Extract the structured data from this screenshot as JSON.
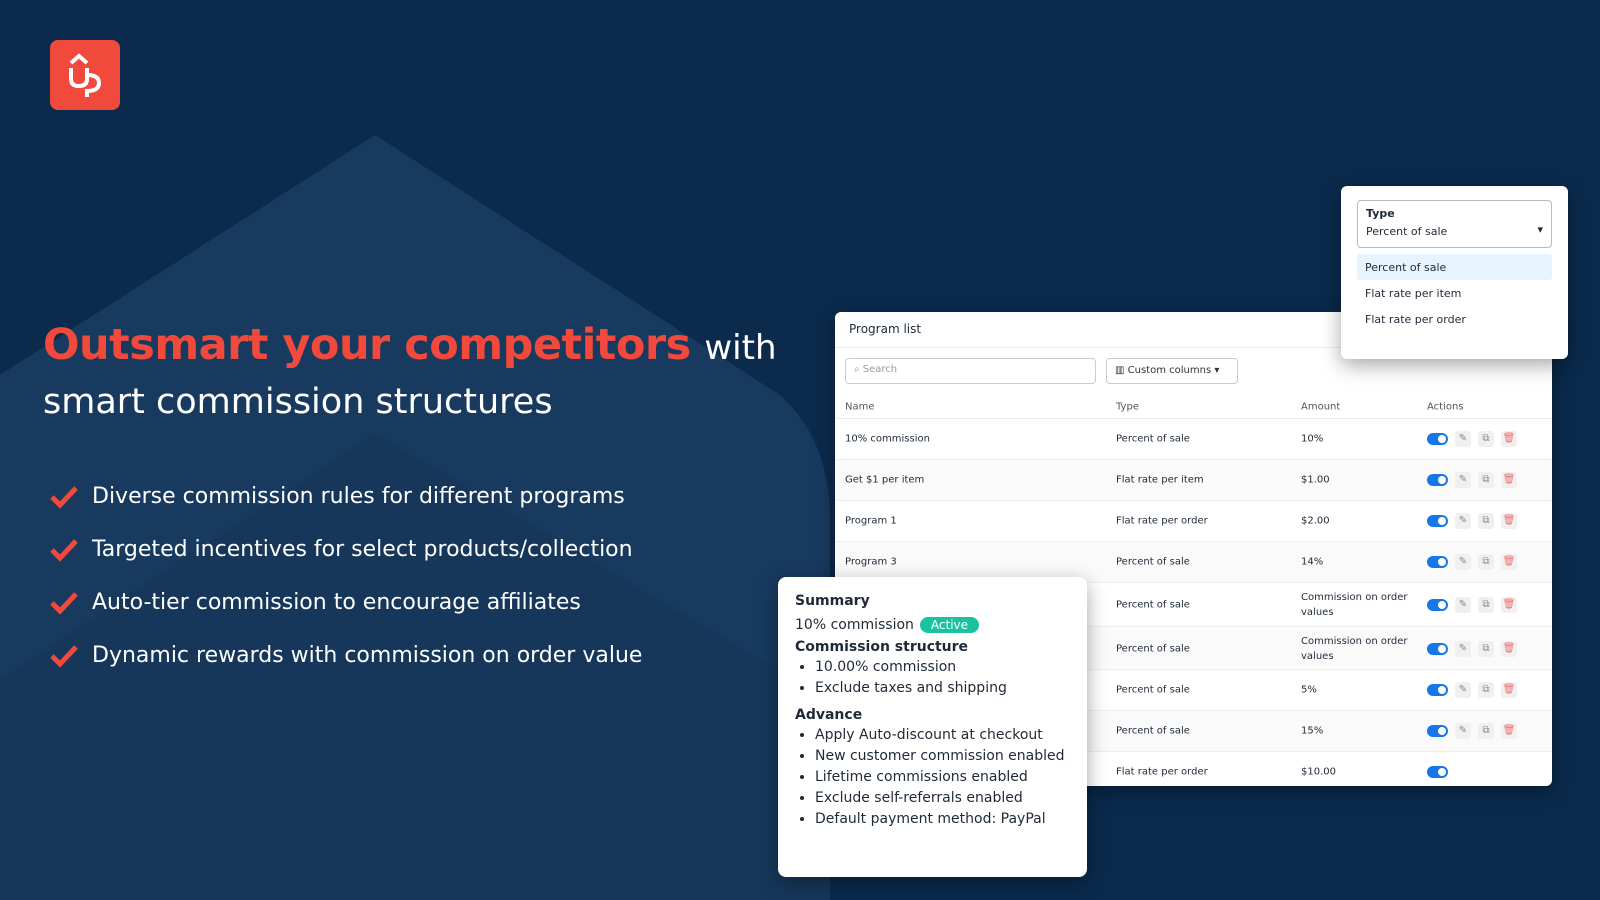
{
  "brand": {
    "logo_text": "Up",
    "color": "#f2493d"
  },
  "hero": {
    "highlight": "Outsmart your competitors",
    "rest": "with",
    "subtitle": "smart commission structures",
    "bullets": [
      "Diverse commission rules for different programs",
      "Targeted incentives for select products/collection",
      "Auto-tier commission to encourage affiliates",
      "Dynamic rewards with commission on order value"
    ]
  },
  "program_list": {
    "title": "Program list",
    "search_placeholder": "Search",
    "custom_columns": "Custom columns",
    "columns": [
      "Name",
      "Type",
      "Amount",
      "Actions"
    ],
    "rows": [
      {
        "name": "10% commission",
        "type": "Percent of sale",
        "amount": "10%"
      },
      {
        "name": "Get $1 per item",
        "type": "Flat rate per item",
        "amount": "$1.00"
      },
      {
        "name": "Program 1",
        "type": "Flat rate per order",
        "amount": "$2.00"
      },
      {
        "name": "Program 3",
        "type": "Percent of sale",
        "amount": "14%"
      },
      {
        "name": "",
        "type": "Percent of sale",
        "amount": "Commission on order values"
      },
      {
        "name": "",
        "type": "Percent of sale",
        "amount": "Commission on order values"
      },
      {
        "name": "",
        "type": "Percent of sale",
        "amount": "5%"
      },
      {
        "name": "",
        "type": "Percent of sale",
        "amount": "15%"
      },
      {
        "name": "",
        "type": "Flat rate per order",
        "amount": "$10.00"
      }
    ]
  },
  "type_dropdown": {
    "label": "Type",
    "value": "Percent of sale",
    "options": [
      "Percent of sale",
      "Flat rate per item",
      "Flat rate per order"
    ]
  },
  "summary": {
    "title": "Summary",
    "program": "10% commission",
    "status": "Active",
    "structure_title": "Commission structure",
    "structure": [
      "10.00% commission",
      "Exclude taxes and shipping"
    ],
    "advance_title": "Advance",
    "advance": [
      "Apply Auto-discount at checkout",
      "New customer commission enabled",
      "Lifetime commissions enabled",
      "Exclude self-referrals enabled",
      "Default payment method: PayPal"
    ]
  }
}
